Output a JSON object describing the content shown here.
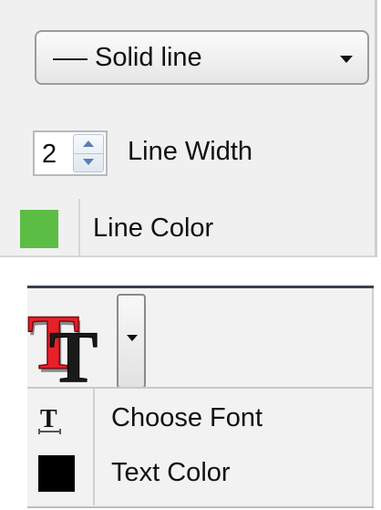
{
  "line_style": {
    "selected": "Solid line",
    "line_icon": "solid-line-icon",
    "arrow_icon": "dropdown-arrow-icon"
  },
  "line_width": {
    "value": "2",
    "label": "Line Width",
    "up_icon": "spin-up-icon",
    "down_icon": "spin-down-icon"
  },
  "line_color": {
    "label": "Line Color",
    "swatch_color": "#5cbd45"
  },
  "text_menu": {
    "button_icon": "text-format-icon",
    "dropdown_icon": "dropdown-arrow-icon",
    "items": [
      {
        "label": "Choose Font",
        "icon": "font-icon"
      },
      {
        "label": "Text Color",
        "icon": "color-swatch-icon",
        "swatch_color": "#000000"
      }
    ]
  }
}
